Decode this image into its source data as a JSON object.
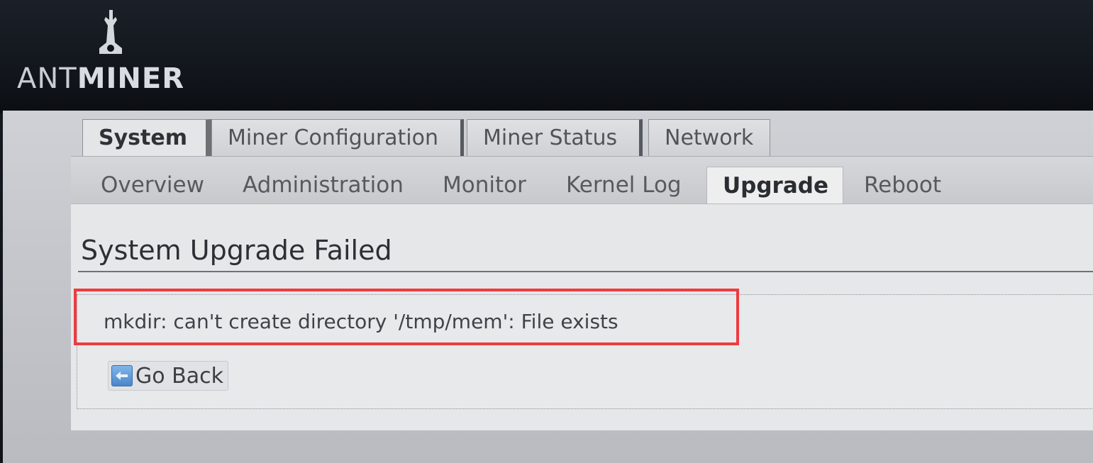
{
  "header": {
    "logo_light": "ANT",
    "logo_bold": "MINER"
  },
  "main_tabs": [
    {
      "label": "System",
      "active": true
    },
    {
      "label": "Miner Configuration",
      "active": false
    },
    {
      "label": "Miner Status",
      "active": false
    },
    {
      "label": "Network",
      "active": false
    }
  ],
  "sub_tabs": [
    {
      "label": "Overview",
      "active": false
    },
    {
      "label": "Administration",
      "active": false
    },
    {
      "label": "Monitor",
      "active": false
    },
    {
      "label": "Kernel Log",
      "active": false
    },
    {
      "label": "Upgrade",
      "active": true
    },
    {
      "label": "Reboot",
      "active": false
    }
  ],
  "main": {
    "title": "System Upgrade Failed",
    "error_message": "mkdir: can't create directory '/tmp/mem': File exists",
    "go_back_label": "Go Back"
  },
  "colors": {
    "highlight_border": "#ee3b3f",
    "header_bg": "#11151b",
    "active_tab_bg": "#eeeeef"
  },
  "icons": {
    "back": "arrow-left-icon",
    "logo": "antminer-logo-mark"
  }
}
